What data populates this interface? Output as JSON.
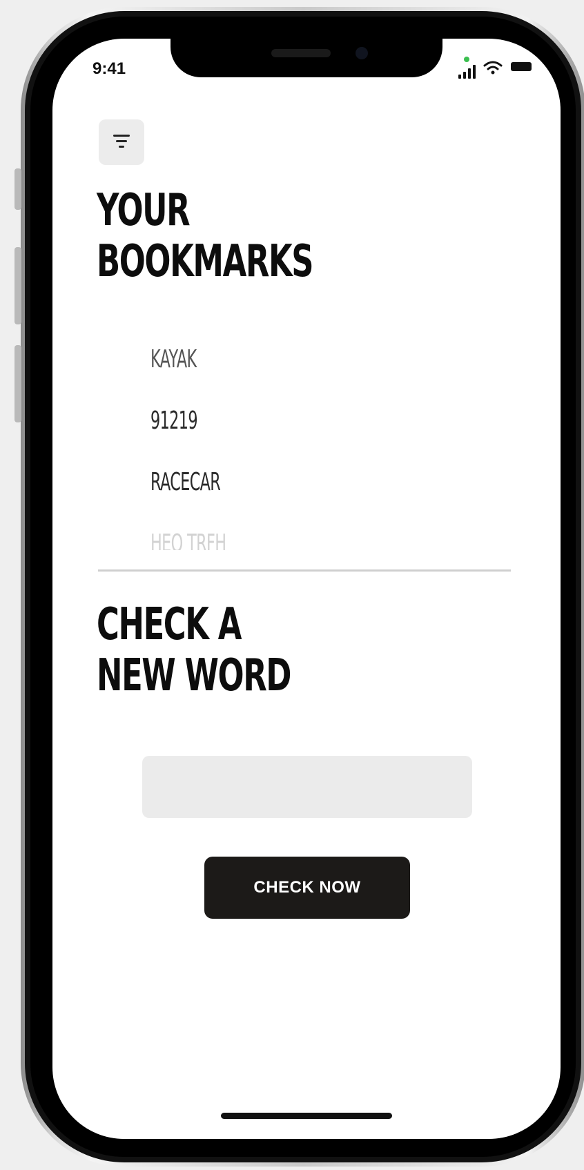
{
  "status_bar": {
    "time": "9:41"
  },
  "header": {
    "filter_icon": "filter-icon"
  },
  "bookmarks": {
    "title_line1": "YOUR",
    "title_line2": "BOOKMARKS",
    "items": [
      {
        "label": "KAYAK",
        "color": "#555555"
      },
      {
        "label": "91219",
        "color": "#2a2a2a"
      },
      {
        "label": "RACECAR",
        "color": "#2a2a2a"
      },
      {
        "label": "HEQ TRFH",
        "color": "#d2d2d2"
      }
    ]
  },
  "check": {
    "title_line1": "CHECK A",
    "title_line2": "NEW WORD",
    "input_value": "",
    "input_placeholder": "",
    "button_label": "CHECK NOW"
  },
  "colors": {
    "background": "#ffffff",
    "button_bg": "#1c1a18",
    "input_bg": "#ebebeb",
    "filter_bg": "#ececec",
    "signal_dot": "#3bbf4f"
  }
}
